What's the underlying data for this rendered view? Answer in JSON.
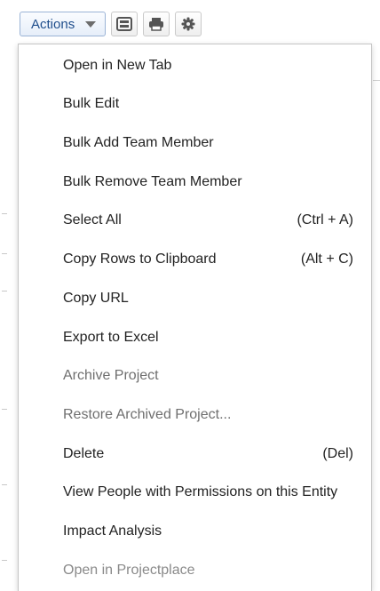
{
  "toolbar": {
    "actions_label": "Actions",
    "icons": [
      "layout-icon",
      "print-icon",
      "gear-icon"
    ]
  },
  "menu": {
    "items": [
      {
        "label": "Open in New Tab",
        "shortcut": "",
        "state": "enabled"
      },
      {
        "label": "Bulk Edit",
        "shortcut": "",
        "state": "enabled"
      },
      {
        "label": "Bulk Add Team Member",
        "shortcut": "",
        "state": "enabled"
      },
      {
        "label": "Bulk Remove Team Member",
        "shortcut": "",
        "state": "enabled"
      },
      {
        "label": "Select All",
        "shortcut": "(Ctrl + A)",
        "state": "enabled"
      },
      {
        "label": "Copy Rows to Clipboard",
        "shortcut": "(Alt + C)",
        "state": "enabled"
      },
      {
        "label": "Copy URL",
        "shortcut": "",
        "state": "enabled"
      },
      {
        "label": "Export to Excel",
        "shortcut": "",
        "state": "enabled"
      },
      {
        "label": "Archive Project",
        "shortcut": "",
        "state": "disabled"
      },
      {
        "label": "Restore Archived Project...",
        "shortcut": "",
        "state": "disabled"
      },
      {
        "label": "Delete",
        "shortcut": "(Del)",
        "state": "enabled"
      },
      {
        "label": "View People with Permissions on this Entity",
        "shortcut": "",
        "state": "enabled"
      },
      {
        "label": "Impact Analysis",
        "shortcut": "",
        "state": "enabled"
      },
      {
        "label": "Open in Projectplace",
        "shortcut": "",
        "state": "muted"
      }
    ]
  },
  "colors": {
    "accent_text": "#1f4e8c",
    "menu_text": "#222222",
    "disabled_text": "#6f6f6f",
    "muted_text": "#8a8a8a"
  }
}
